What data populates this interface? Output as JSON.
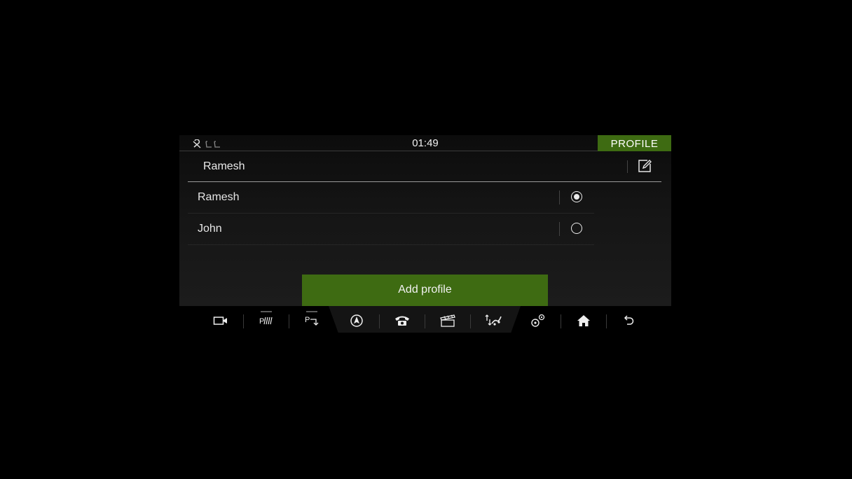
{
  "statusbar": {
    "time": "01:49",
    "profile_tab": "PROFILE",
    "icons": [
      "seatbelt-warning-icon",
      "seat-icon"
    ]
  },
  "current_profile": {
    "name": "Ramesh",
    "edit_icon": "edit-icon"
  },
  "profiles": [
    {
      "label": "Ramesh",
      "selected": true
    },
    {
      "label": "John",
      "selected": false
    }
  ],
  "add_profile_label": "Add profile",
  "colors": {
    "accent": "#3e6b12",
    "background": "#000000"
  },
  "navbar": {
    "items": [
      "camera-icon",
      "park-assist-icon",
      "park-exit-icon",
      "navigation-icon",
      "phone-icon",
      "media-icon",
      "terrain-icon",
      "settings-icon",
      "home-icon",
      "back-icon"
    ]
  }
}
